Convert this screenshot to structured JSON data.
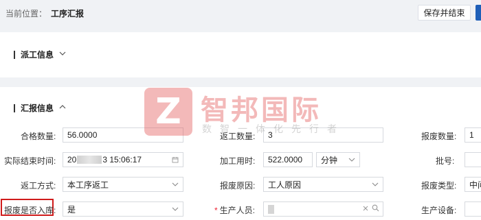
{
  "breadcrumb": {
    "prefix": "当前位置：",
    "current": "工序汇报"
  },
  "toolbar": {
    "save_label": "保存并结束"
  },
  "sections": {
    "dispatch_title": "派工信息",
    "report_title": "汇报信息"
  },
  "watermark": {
    "logo_letter": "Z",
    "title": "智邦国际",
    "subtitle": "数智一体化先行者"
  },
  "form": {
    "qualified_qty": {
      "label": "合格数量:",
      "value": "56.0000"
    },
    "rework_qty": {
      "label": "返工数量:",
      "value": "3"
    },
    "scrap_qty": {
      "label": "报废数量:",
      "value": "1"
    },
    "actual_end_time": {
      "label": "实际结束时间:",
      "value_prefix": "20",
      "value_suffix": "3 15:06:17"
    },
    "work_hours": {
      "label": "加工用时:",
      "value": "522.0000",
      "unit": "分钟"
    },
    "batch_no": {
      "label": "批号:",
      "value": ""
    },
    "rework_method": {
      "label": "返工方式:",
      "value": "本工序返工"
    },
    "scrap_reason": {
      "label": "报废原因:",
      "value": "工人原因"
    },
    "scrap_type": {
      "label": "报废类型:",
      "value": "中间"
    },
    "scrap_in_stock": {
      "label": "报废是否入库:",
      "value": "是"
    },
    "producer": {
      "label": "生产人员:",
      "required_mark": "*",
      "value": ""
    },
    "equipment": {
      "label": "生产设备:",
      "value": ""
    }
  },
  "colors": {
    "accent": "#1f5fb8",
    "highlight_box": "#d01a1a",
    "required": "#e22233"
  }
}
